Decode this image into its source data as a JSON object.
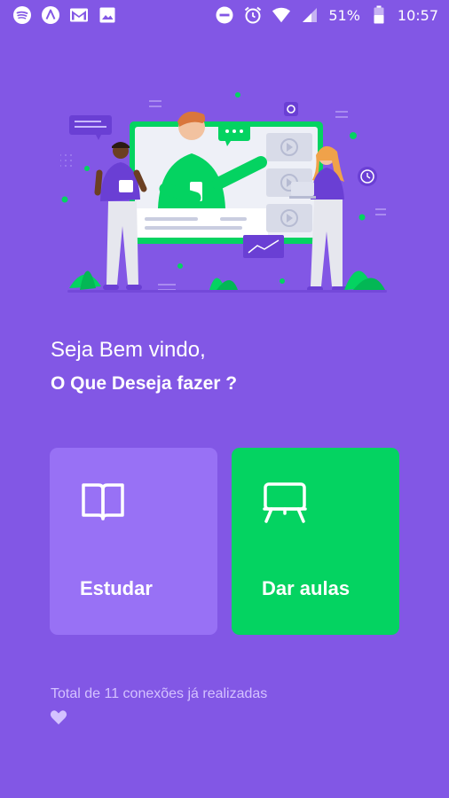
{
  "status_bar": {
    "left_icons": [
      "spotify-icon",
      "navigation-app-icon",
      "gmail-icon",
      "image-icon"
    ],
    "right_icons": [
      "do-not-disturb-icon",
      "alarm-icon",
      "wifi-icon",
      "cell-signal-icon",
      "battery-icon"
    ],
    "battery": "51%",
    "time": "10:57"
  },
  "hero": {
    "illustration": "online-class-illustration"
  },
  "welcome": {
    "line1": "Seja Bem vindo,",
    "line2": "O Que Deseja fazer ?"
  },
  "actions": {
    "study_label": "Estudar",
    "teach_label": "Dar aulas"
  },
  "footer": {
    "connections_text": "Total de 11 conexões já realizadas"
  },
  "colors": {
    "background": "#8257e5",
    "study_card": "#9871f5",
    "teach_card": "#04d361",
    "secondary_text": "#d4c2ff"
  }
}
